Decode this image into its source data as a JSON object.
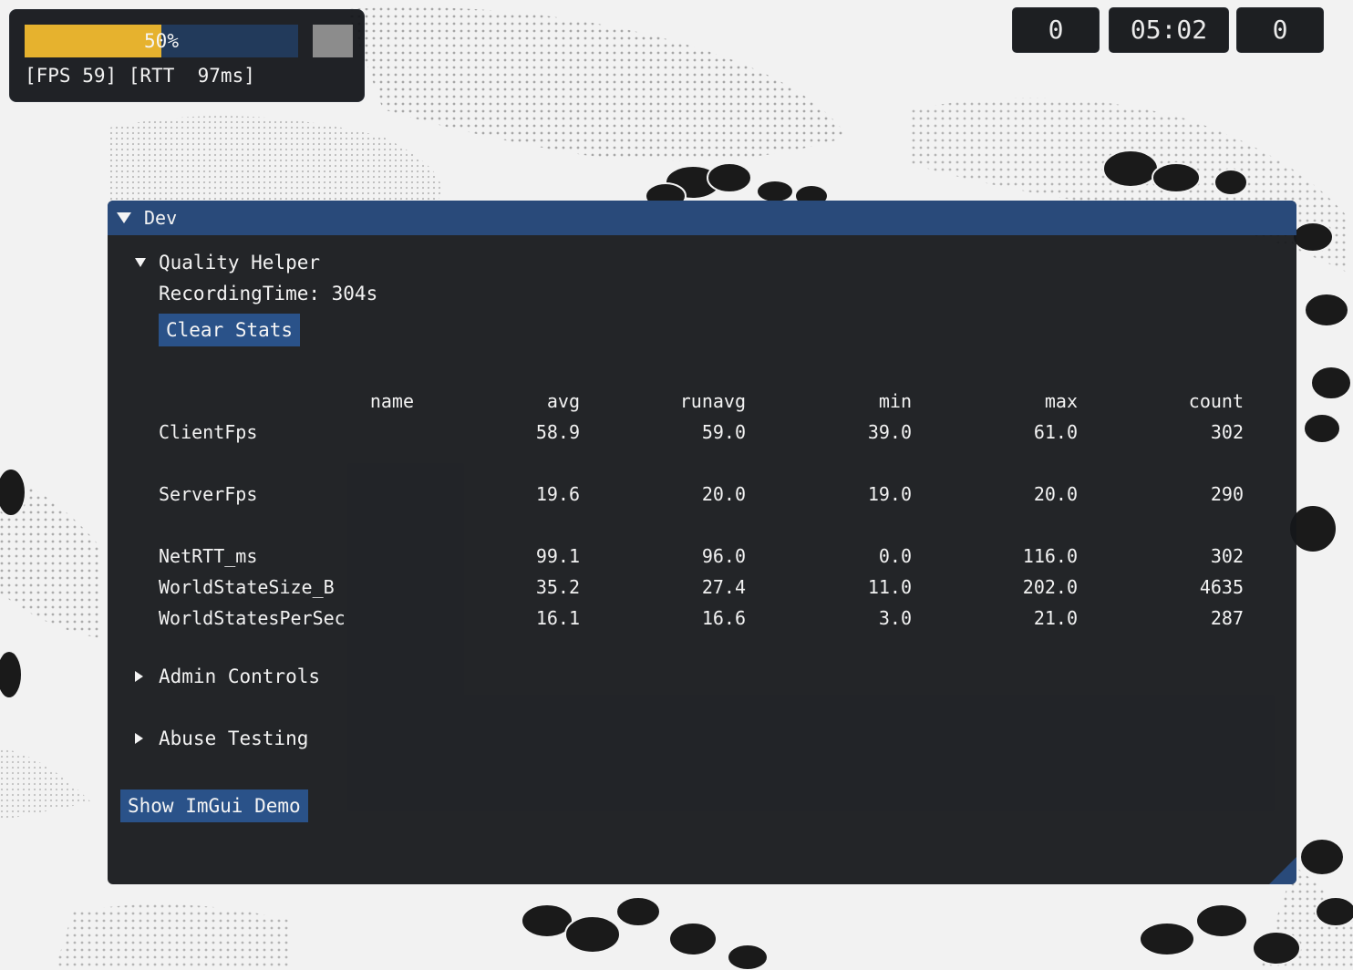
{
  "hud": {
    "progress_label": "50%",
    "progress_value": 0.5,
    "stats_text": "[FPS 59] [RTT  97ms]",
    "colors": {
      "progress_fill": "#e6b22e",
      "progress_track": "#223a5b"
    }
  },
  "score": {
    "left": "0",
    "timer": "05:02",
    "right": "0"
  },
  "dev": {
    "title": "Dev",
    "quality_helper": {
      "label": "Quality Helper",
      "recording_time": "RecordingTime: 304s",
      "clear_button": "Clear Stats",
      "columns": [
        "name",
        "avg",
        "runavg",
        "min",
        "max",
        "count"
      ],
      "rows": [
        {
          "name": "ClientFps",
          "avg": "58.9",
          "runavg": "59.0",
          "min": "39.0",
          "max": "61.0",
          "count": "302"
        },
        {
          "name": "ServerFps",
          "avg": "19.6",
          "runavg": "20.0",
          "min": "19.0",
          "max": "20.0",
          "count": "290"
        },
        {
          "name": "NetRTT_ms",
          "avg": "99.1",
          "runavg": "96.0",
          "min": "0.0",
          "max": "116.0",
          "count": "302"
        },
        {
          "name": "WorldStateSize_B",
          "avg": "35.2",
          "runavg": "27.4",
          "min": "11.0",
          "max": "202.0",
          "count": "4635"
        },
        {
          "name": "WorldStatesPerSec",
          "avg": "16.1",
          "runavg": "16.6",
          "min": "3.0",
          "max": "21.0",
          "count": "287"
        }
      ]
    },
    "admin_controls": "Admin Controls",
    "abuse_testing": "Abuse Testing",
    "show_demo_button": "Show ImGui Demo",
    "colors": {
      "title_bar": "#294a7a",
      "button": "#2a5289"
    }
  }
}
